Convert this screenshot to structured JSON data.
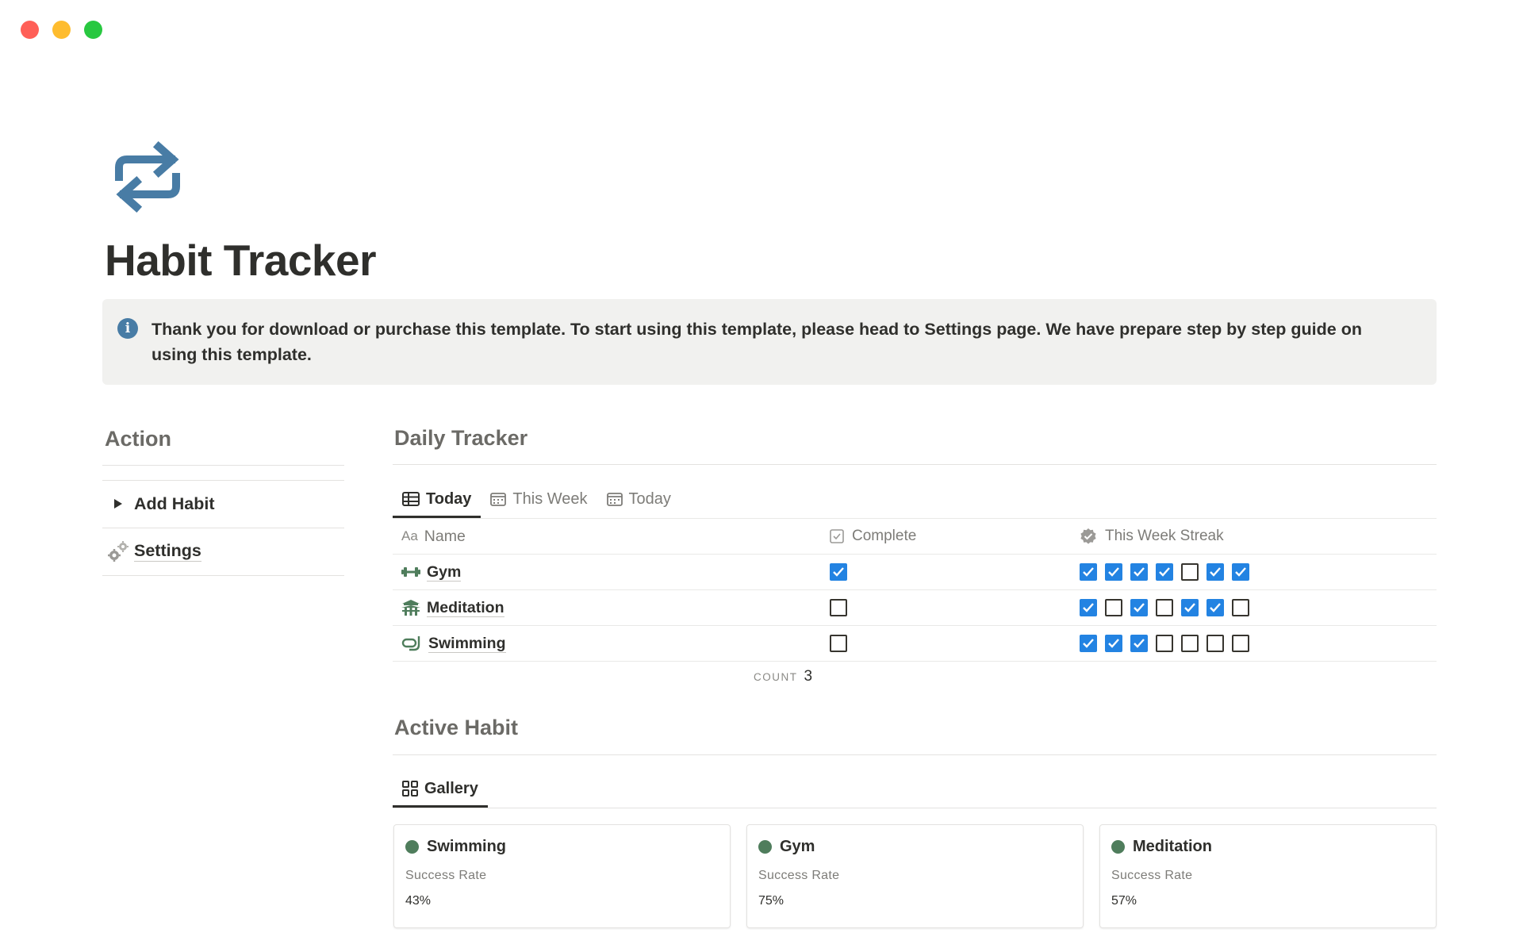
{
  "page": {
    "title": "Habit Tracker",
    "icon": "repeat-arrows-icon",
    "accent_color": "#487ca5"
  },
  "callout": {
    "icon": "info-icon",
    "icon_glyph": "i",
    "text": "Thank you for download or purchase this template. To start using this template, please head to Settings page. We have prepare step by step guide on using this template."
  },
  "action": {
    "heading": "Action",
    "items": [
      {
        "label": "Add Habit",
        "icon": "triangle-right-icon"
      },
      {
        "label": "Settings",
        "icon": "gears-icon"
      }
    ]
  },
  "daily_tracker": {
    "heading": "Daily Tracker",
    "tabs": [
      {
        "label": "Today",
        "icon": "table-icon",
        "active": true
      },
      {
        "label": "This Week",
        "icon": "calendar-icon",
        "active": false
      },
      {
        "label": "Today",
        "icon": "calendar-icon",
        "active": false
      }
    ],
    "columns": {
      "name": "Name",
      "name_prefix": "Aa",
      "complete": "Complete",
      "streak": "This Week Streak"
    },
    "rows": [
      {
        "name": "Gym",
        "icon": "dumbbell-icon",
        "complete": true,
        "streak": [
          true,
          true,
          true,
          true,
          false,
          true,
          true
        ]
      },
      {
        "name": "Meditation",
        "icon": "temple-icon",
        "complete": false,
        "streak": [
          true,
          false,
          true,
          false,
          true,
          true,
          false
        ]
      },
      {
        "name": "Swimming",
        "icon": "snorkel-icon",
        "complete": false,
        "streak": [
          true,
          true,
          true,
          false,
          false,
          false,
          false
        ]
      }
    ],
    "count_label": "COUNT",
    "count_value": "3",
    "checkbox_color": "#2383e2"
  },
  "active_habit": {
    "heading": "Active Habit",
    "tab": {
      "label": "Gallery",
      "icon": "gallery-icon"
    },
    "cards": [
      {
        "name": "Swimming",
        "label": "Success Rate",
        "value": "43%",
        "dot_color": "#4f7d5c"
      },
      {
        "name": "Gym",
        "label": "Success Rate",
        "value": "75%",
        "dot_color": "#4f7d5c"
      },
      {
        "name": "Meditation",
        "label": "Success Rate",
        "value": "57%",
        "dot_color": "#4f7d5c"
      }
    ]
  }
}
